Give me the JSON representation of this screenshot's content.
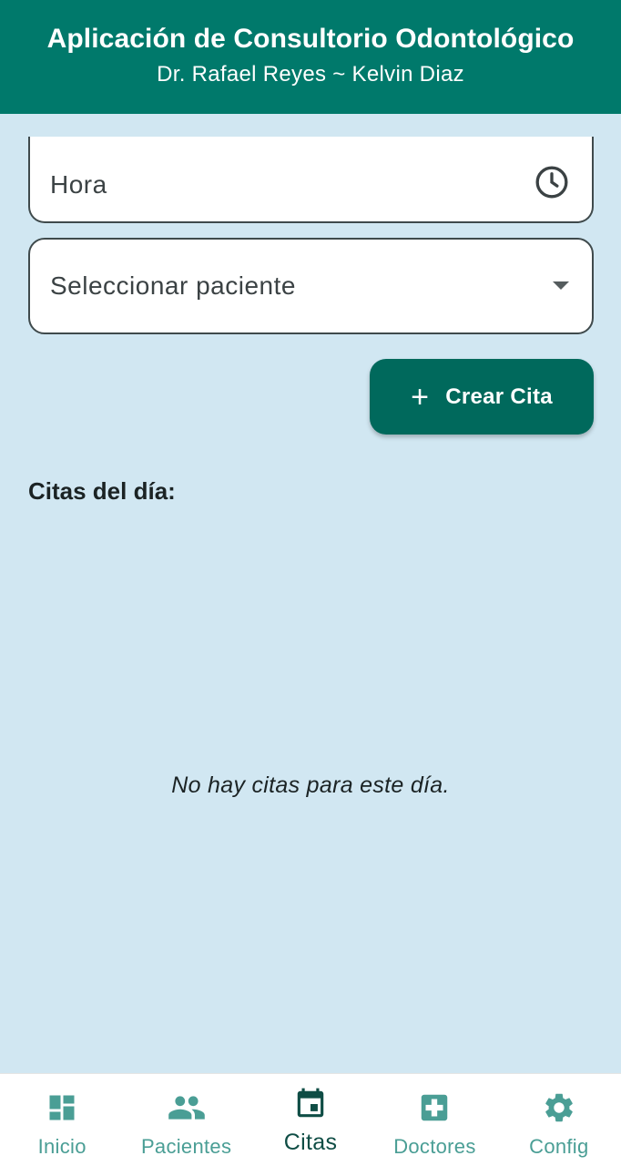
{
  "header": {
    "title": "Aplicación de Consultorio Odontológico",
    "subtitle": "Dr. Rafael Reyes ~ Kelvin Diaz"
  },
  "form": {
    "hora_label": "Hora",
    "hora_icon": "clock-icon",
    "paciente_label": "Seleccionar paciente",
    "paciente_icon": "dropdown-arrow-icon"
  },
  "actions": {
    "create_label": "Crear Cita",
    "create_icon": "plus-icon"
  },
  "appointments": {
    "section_title": "Citas del día:",
    "empty_message": "No hay citas para este día."
  },
  "nav": {
    "items": [
      {
        "label": "Inicio",
        "icon": "dashboard-icon",
        "active": false
      },
      {
        "label": "Pacientes",
        "icon": "people-icon",
        "active": false
      },
      {
        "label": "Citas",
        "icon": "calendar-icon",
        "active": true
      },
      {
        "label": "Doctores",
        "icon": "medical-cross-icon",
        "active": false
      },
      {
        "label": "Config",
        "icon": "gear-icon",
        "active": false
      }
    ]
  },
  "colors": {
    "primary": "#00796b",
    "button": "#00695c",
    "background": "#d1e7f2",
    "nav_inactive": "#4a9e95",
    "nav_active": "#0f4d45"
  }
}
